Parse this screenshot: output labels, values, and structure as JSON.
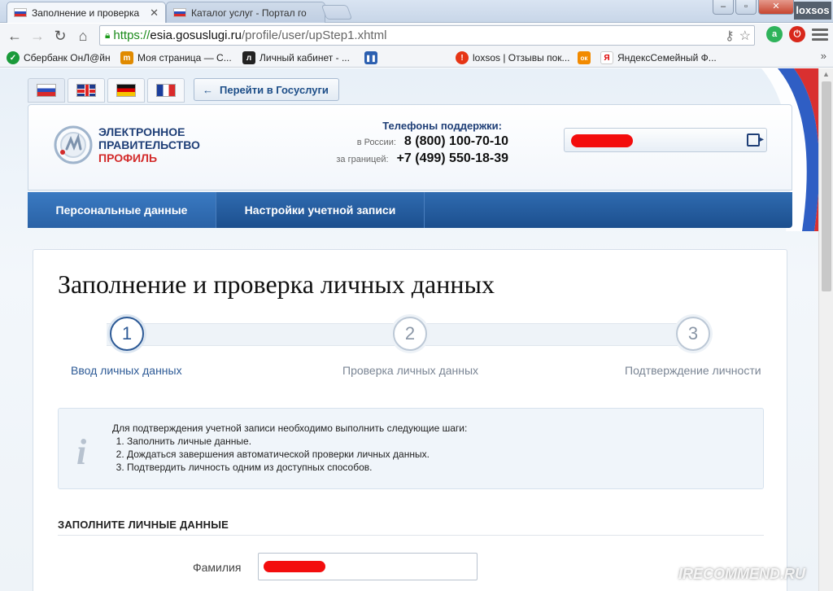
{
  "browser": {
    "tabs": [
      {
        "title": "Заполнение и проверка",
        "active": true
      },
      {
        "title": "Каталог услуг - Портал го",
        "active": false
      }
    ],
    "profile_name": "loxsos",
    "window_buttons": {
      "minimize": "–",
      "maximize": "▫",
      "close": "✕"
    },
    "url": {
      "scheme": "https://",
      "host": "esia.gosuslugi.ru",
      "path": "/profile/user/upStep1.xhtml"
    },
    "bookmarks": [
      {
        "label": "Сбербанк ОнЛ@йн",
        "icon": "sberbank-icon",
        "color": "#1a9a3a",
        "glyph": "✓"
      },
      {
        "label": "Моя страница — С...",
        "icon": "page-icon",
        "color": "#e08a00",
        "glyph": "m"
      },
      {
        "label": "Личный кабинет - ...",
        "icon": "cabinet-icon",
        "color": "#222222",
        "glyph": "л"
      },
      {
        "label": "",
        "icon": "pause-icon",
        "color": "#2b5fb0",
        "glyph": "❚❚"
      },
      {
        "label": "loxsos | Отзывы пок...",
        "icon": "irecommend-icon",
        "color": "#e63515",
        "glyph": "!"
      },
      {
        "label": "",
        "icon": "odnoklassniki-icon",
        "color": "#f28a00",
        "glyph": "ок"
      },
      {
        "label": "ЯндексСемейный Ф...",
        "icon": "yandex-icon",
        "color": "#ffffff",
        "glyph": "Я"
      }
    ],
    "bookmarks_more": "»"
  },
  "page": {
    "goto_button": "Перейти в Госуслуги",
    "logo": {
      "line1": "ЭЛЕКТРОННОЕ",
      "line2": "ПРАВИТЕЛЬСТВО",
      "line3": "ПРОФИЛЬ"
    },
    "support": {
      "title": "Телефоны поддержки:",
      "russia_label": "в России:",
      "russia_phone": "8 (800) 100-70-10",
      "abroad_label": "за границей:",
      "abroad_phone": "+7 (499) 550-18-39"
    },
    "nav": [
      {
        "label": "Персональные данные",
        "active": true
      },
      {
        "label": "Настройки учетной записи",
        "active": false
      }
    ],
    "heading": "Заполнение и проверка личных данных",
    "steps": [
      {
        "number": "1",
        "label": "Ввод личных данных",
        "active": true
      },
      {
        "number": "2",
        "label": "Проверка личных данных",
        "active": false
      },
      {
        "number": "3",
        "label": "Подтверждение личности",
        "active": false
      }
    ],
    "info": {
      "intro": "Для подтверждения учетной записи необходимо выполнить следующие шаги:",
      "items": [
        "Заполнить личные данные.",
        "Дождаться завершения автоматической проверки личных данных.",
        "Подтвердить личность одним из доступных способов."
      ]
    },
    "section_title": "ЗАПОЛНИТЕ ЛИЧНЫЕ ДАННЫЕ",
    "fields": [
      {
        "label": "Фамилия"
      }
    ]
  },
  "watermark": "IRECOMMEND.RU",
  "colors": {
    "accent": "#1f3f77",
    "nav": "#2a62a6",
    "redaction": "#f30d0d"
  }
}
